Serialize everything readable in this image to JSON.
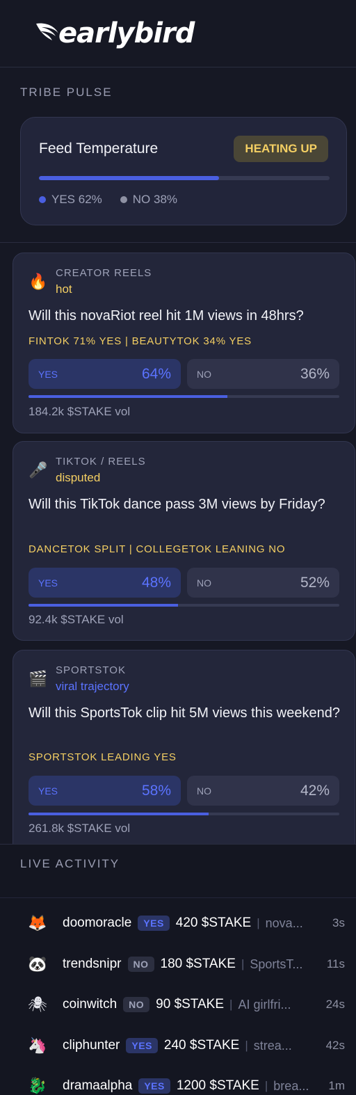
{
  "brand": {
    "name": "earlybird"
  },
  "tribe_pulse": {
    "label": "TRIBE PULSE",
    "title": "Feed Temperature",
    "status": "HEATING UP",
    "yes_fraction": 0.62,
    "yes_label": "YES 62%",
    "no_label": "NO 38%"
  },
  "markets": [
    {
      "icon": "fire-icon",
      "emoji": "🔥",
      "category": "CREATOR REELS",
      "tag": "hot",
      "question": "Will this novaRiot reel hit 1M views in 48hrs?",
      "sentiment": "FINTOK 71% YES | BEAUTYTOK 34% YES",
      "yes_label": "YES",
      "yes_pct": "64%",
      "no_label": "NO",
      "no_pct": "36%",
      "yes_fraction": 0.64,
      "volume": "184.2k $STAKE vol"
    },
    {
      "icon": "microphone-icon",
      "emoji": "🎤",
      "category": "TIKTOK / REELS",
      "tag": "disputed",
      "question": "Will this TikTok dance pass 3M views by Friday?",
      "sentiment": "DANCETOK SPLIT | COLLEGETOK LEANING NO",
      "yes_label": "YES",
      "yes_pct": "48%",
      "no_label": "NO",
      "no_pct": "52%",
      "yes_fraction": 0.48,
      "volume": "92.4k $STAKE vol"
    },
    {
      "icon": "clapperboard-icon",
      "emoji": "🎬",
      "category": "SPORTSTOK",
      "tag": "viral trajectory",
      "question": "Will this SportsTok clip hit 5M views this weekend?",
      "sentiment": "SPORTSTOK LEADING YES",
      "yes_label": "YES",
      "yes_pct": "58%",
      "no_label": "NO",
      "no_pct": "42%",
      "yes_fraction": 0.58,
      "volume": "261.8k $STAKE vol"
    }
  ],
  "live_activity": {
    "label": "LIVE ACTIVITY",
    "items": [
      {
        "avatar": "fox-icon",
        "emoji": "🦊",
        "user": "doomoracle",
        "side": "YES",
        "amount": "420 $STAKE",
        "separator": "|",
        "target": "nova...",
        "time": "3s"
      },
      {
        "avatar": "panda-icon",
        "emoji": "🐼",
        "user": "trendsnipr",
        "side": "NO",
        "amount": "180 $STAKE",
        "separator": "|",
        "target": "SportsT...",
        "time": "11s"
      },
      {
        "avatar": "spider-icon",
        "emoji": "🕷",
        "user": "coinwitch",
        "side": "NO",
        "amount": "90 $STAKE",
        "separator": "|",
        "target": "AI girlfri...",
        "time": "24s"
      },
      {
        "avatar": "unicorn-icon",
        "emoji": "🦄",
        "user": "cliphunter",
        "side": "YES",
        "amount": "240 $STAKE",
        "separator": "|",
        "target": "strea...",
        "time": "42s"
      },
      {
        "avatar": "dragon-icon",
        "emoji": "🐉",
        "user": "dramaalpha",
        "side": "YES",
        "amount": "1200 $STAKE",
        "separator": "|",
        "target": "brea...",
        "time": "1m"
      }
    ]
  },
  "colors": {
    "background": "#161824",
    "card": "#23263a",
    "accent_blue": "#4a5fe0",
    "accent_yellow": "#f4cf63",
    "muted_text": "#9ea2b8"
  }
}
